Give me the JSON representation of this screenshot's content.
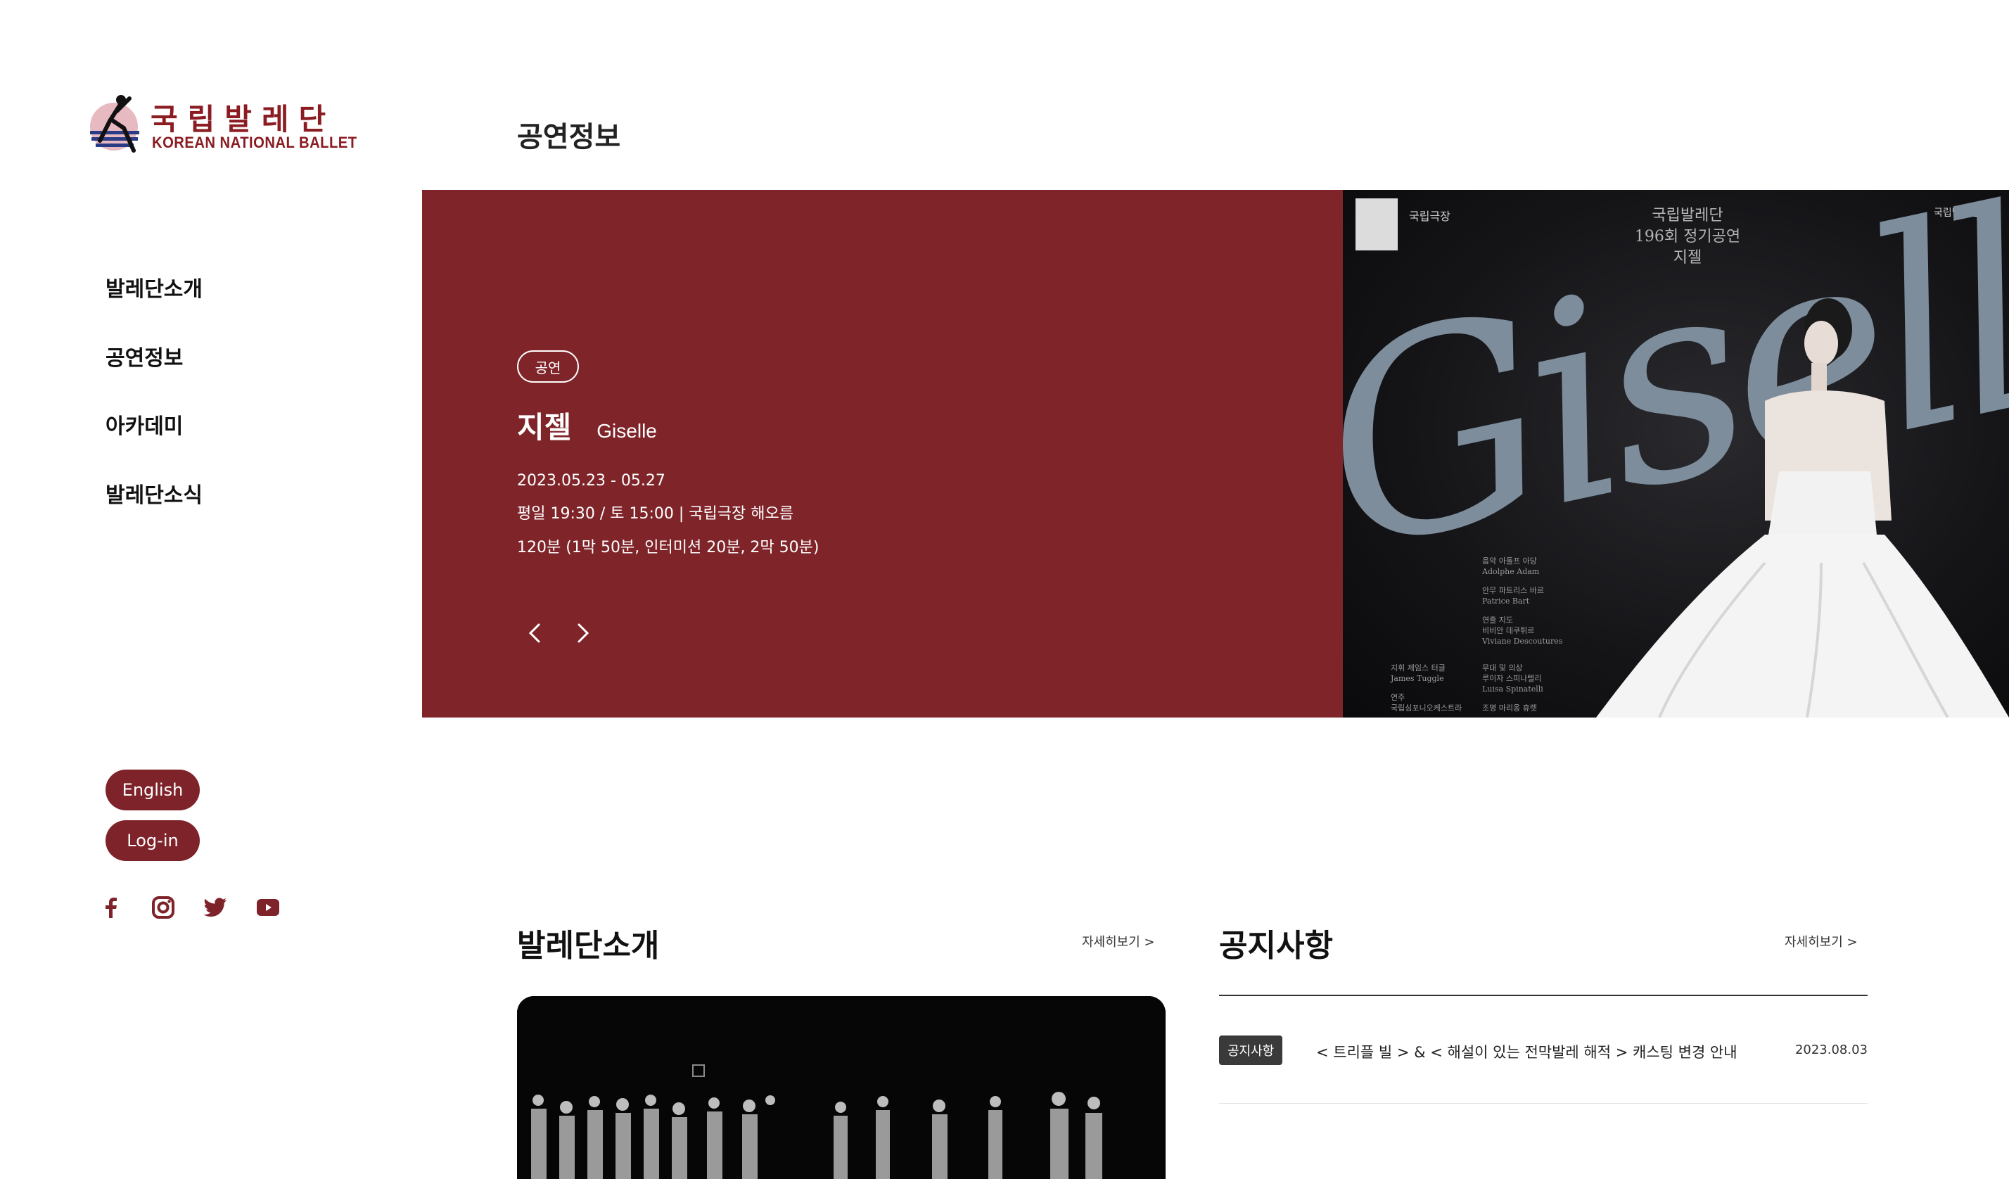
{
  "brand": {
    "name_ko": "국립발레단",
    "name_en": "KOREAN NATIONAL BALLET",
    "color": "#7f252a"
  },
  "sidebar": {
    "nav": [
      {
        "label": "발레단소개"
      },
      {
        "label": "공연정보"
      },
      {
        "label": "아카데미"
      },
      {
        "label": "발레단소식"
      }
    ],
    "buttons": {
      "language": "English",
      "login": "Log-in"
    },
    "social": [
      "facebook-icon",
      "instagram-icon",
      "twitter-icon",
      "youtube-icon"
    ]
  },
  "page_title": "공연정보",
  "hero": {
    "tag": "공연",
    "title_ko": "지젤",
    "title_en": "Giselle",
    "date": "2023.05.23 - 05.27",
    "time_venue": "평일 19:30 / 토 15:00 | 국립극장 해오름",
    "runtime": "120분 (1막 50분, 인터미션 20분, 2막 50분)",
    "poster": {
      "word": "Giselle",
      "theater": "국립극장",
      "header_lines": [
        "국립발레단",
        "196회 정기공연",
        "지젤"
      ],
      "brand_mark": "국립발레단",
      "credits": [
        "음악 아돌프 아당",
        "Adolphe Adam",
        "안무 파트리스 바르",
        "Patrice Bart",
        "연출 지도",
        "비비안 데쿠튀르",
        "Viviane Descoutures",
        "지휘 제임스 터글",
        "James Tuggle",
        "무대 및 의상",
        "루이자 스피나텔리",
        "Luisa Spinatelli",
        "연주",
        "국립심포니오케스트라",
        "조명 마리옹 휴렛"
      ]
    }
  },
  "intro": {
    "title": "발레단소개",
    "more": "자세히보기   >"
  },
  "notice": {
    "title": "공지사항",
    "more": "자세히보기   >",
    "items": [
      {
        "badge": "공지사항",
        "text": "< 트리플 빌 > & < 해설이 있는 전막발레 해적 > 캐스팅 변경 안내",
        "date": "2023.08.03"
      }
    ]
  }
}
